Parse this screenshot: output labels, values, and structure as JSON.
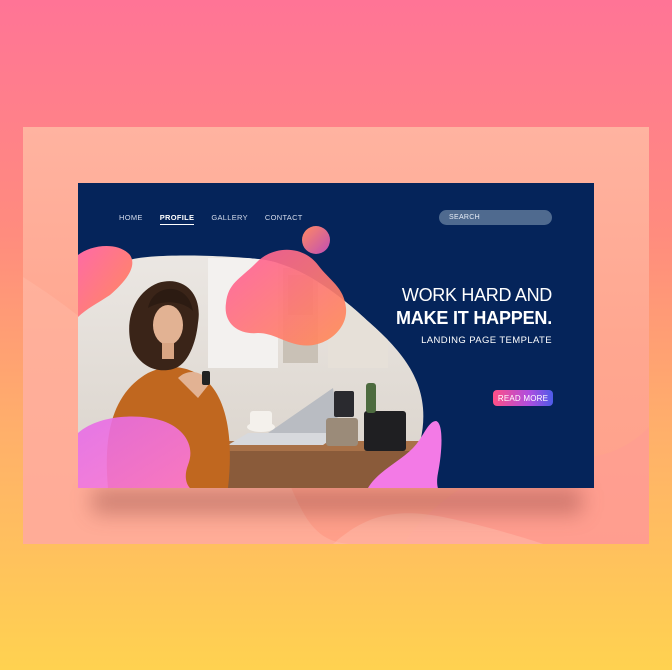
{
  "nav": {
    "items": [
      {
        "label": "HOME",
        "active": false
      },
      {
        "label": "PROFILE",
        "active": true
      },
      {
        "label": "GALLERY",
        "active": false
      },
      {
        "label": "CONTACT",
        "active": false
      }
    ]
  },
  "search": {
    "placeholder": "SEARCH"
  },
  "hero": {
    "line1": "WORK HARD AND",
    "line2": "MAKE IT HAPPEN.",
    "subtitle": "LANDING PAGE TEMPLATE",
    "cta_label": "READ MORE",
    "image_icon": "woman-with-laptop-photo"
  },
  "colors": {
    "page_bg_top": "#ff7496",
    "page_bg_bottom": "#ffd250",
    "backdrop": "#ffaa92",
    "card_bg": "#05245a",
    "accent_pink": "#ff4f86",
    "accent_orange": "#ff8a5c",
    "accent_violet": "#f07cf0",
    "cta_start": "#ff4f86",
    "cta_end": "#4d5be8"
  }
}
